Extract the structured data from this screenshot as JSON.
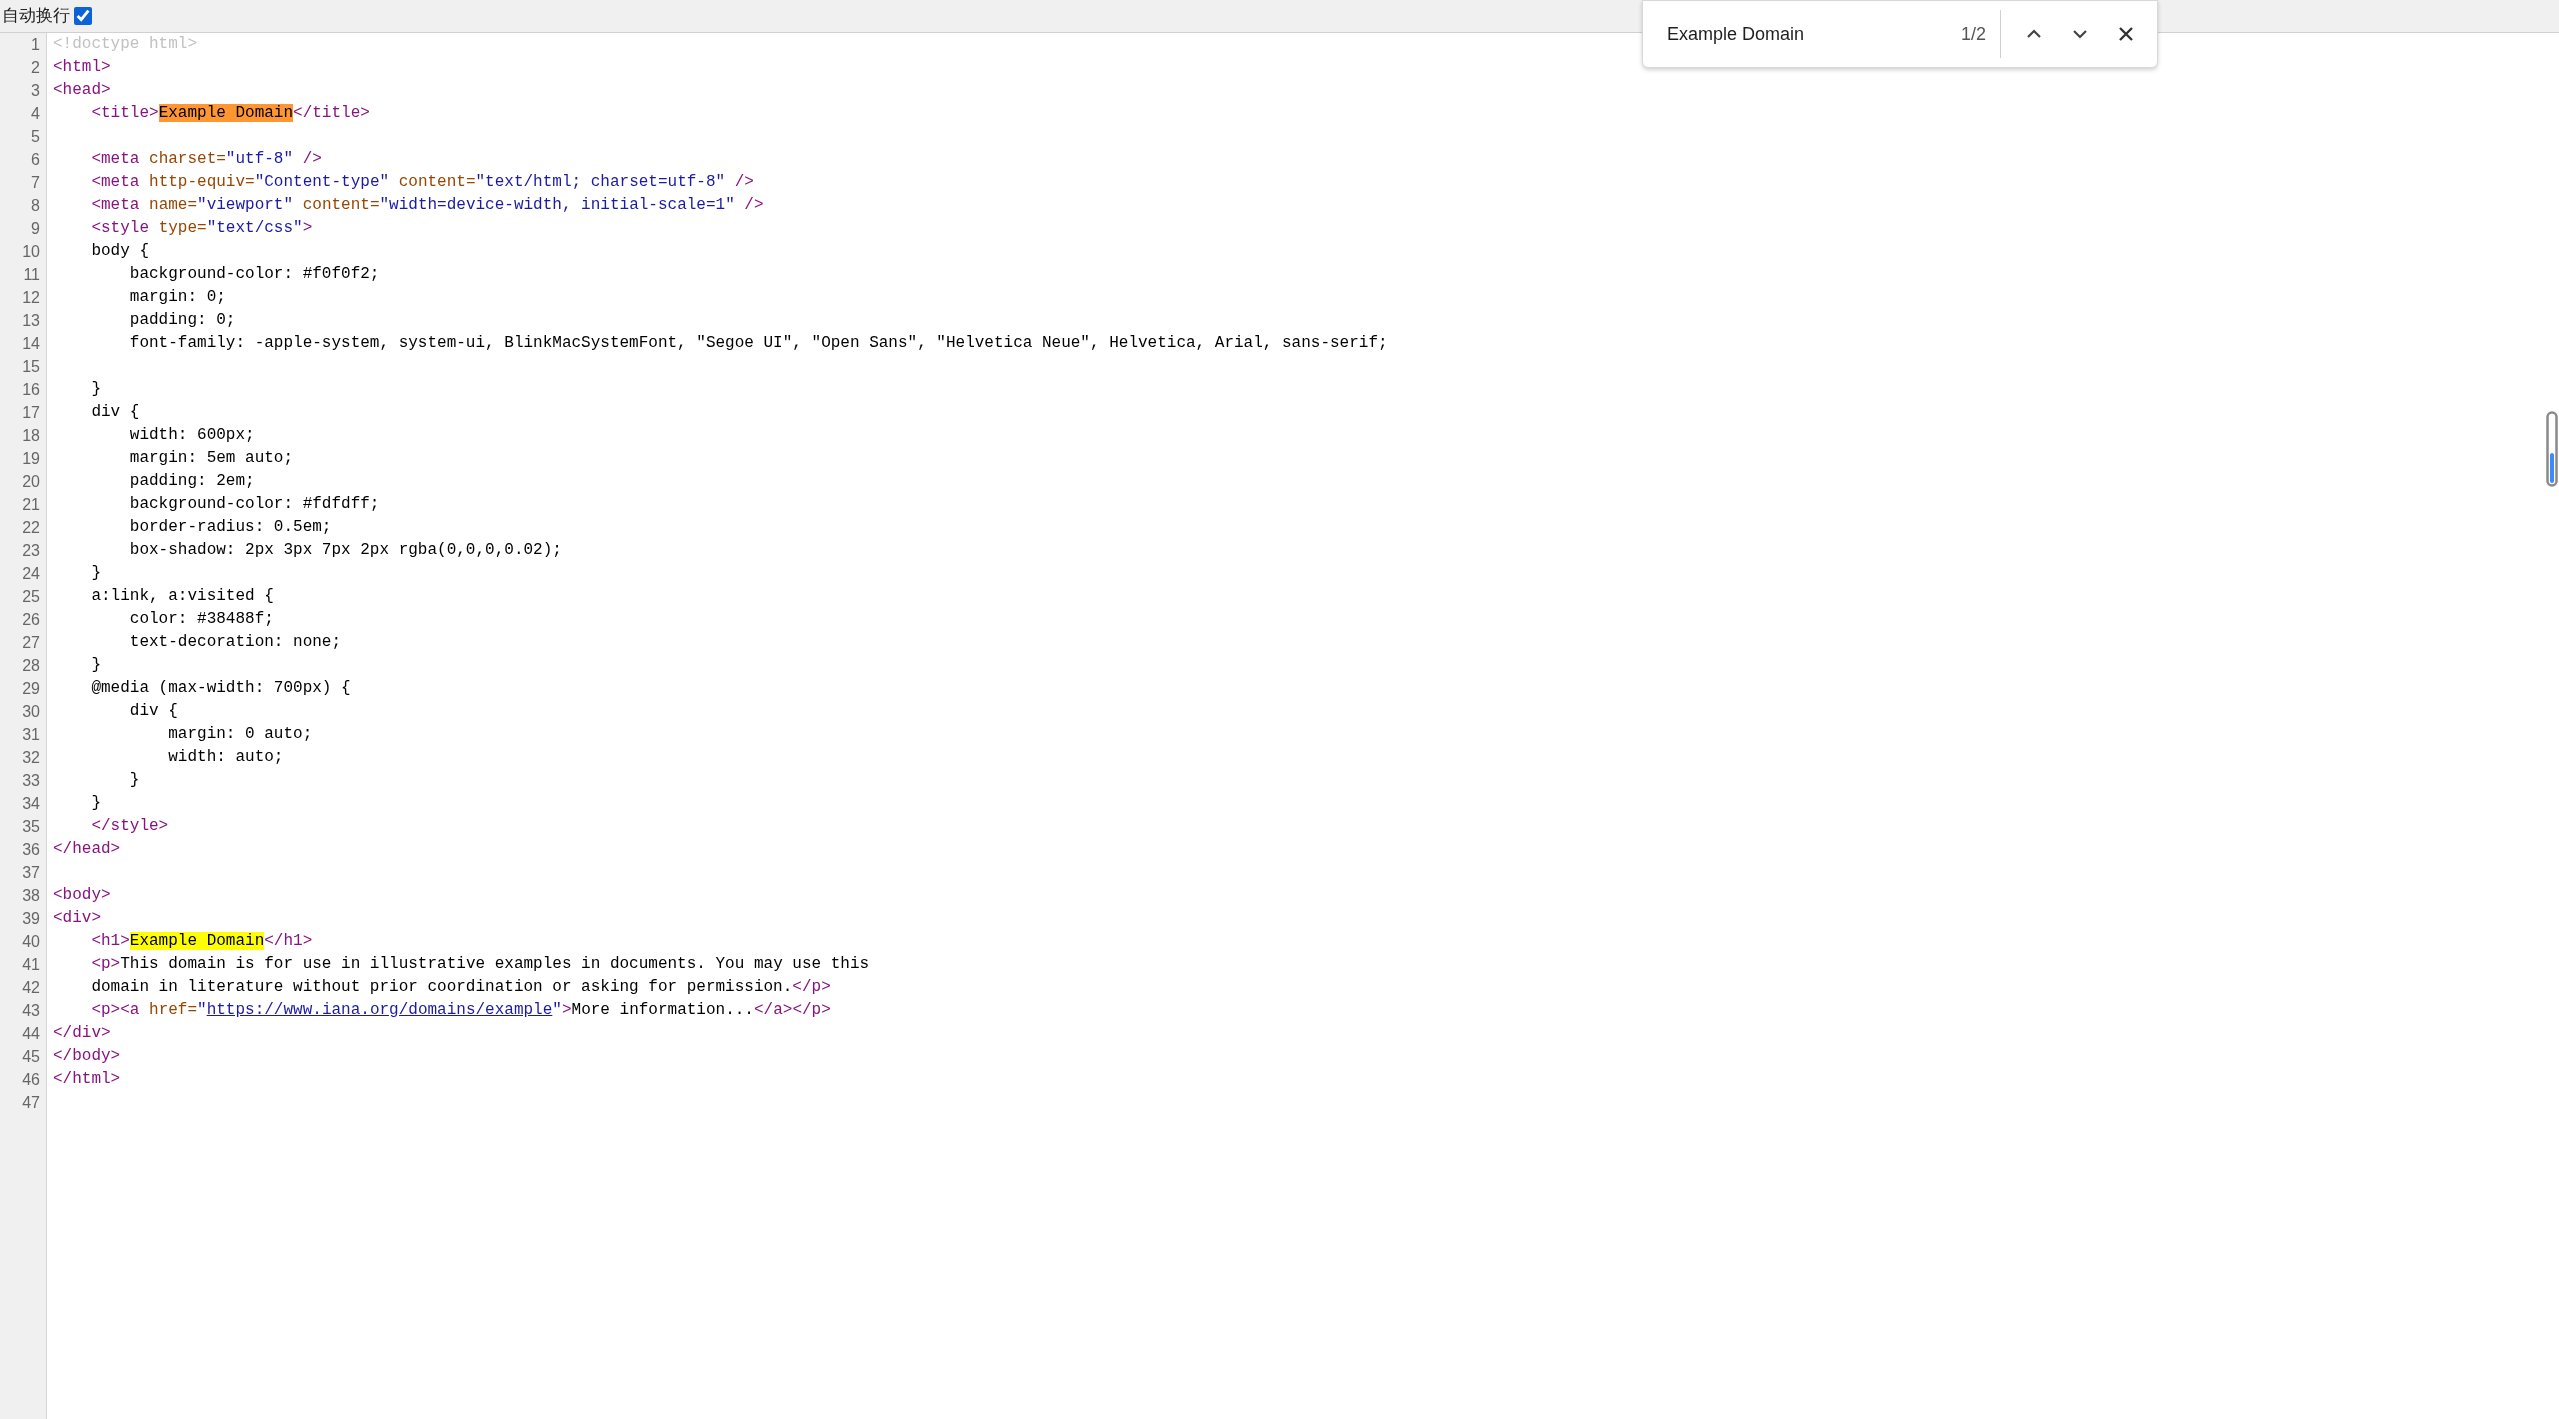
{
  "toolbar": {
    "wrap_label": "自动换行",
    "wrap_checked": true
  },
  "lines": [
    {
      "number": "1",
      "tokens": [
        {
          "kind": "doctype",
          "text": "<!doctype html>"
        }
      ]
    },
    {
      "number": "2",
      "tokens": [
        {
          "kind": "tag",
          "text": "<html>"
        }
      ]
    },
    {
      "number": "3",
      "tokens": [
        {
          "kind": "tag",
          "text": "<head>"
        }
      ]
    },
    {
      "number": "4",
      "tokens": [
        {
          "kind": "tag",
          "text": "    <title>"
        },
        {
          "kind": "match",
          "text": "Example Domain",
          "selected": true
        },
        {
          "kind": "tag",
          "text": "</title>"
        }
      ]
    },
    {
      "number": "5"
    },
    {
      "number": "6",
      "tokens": [
        {
          "kind": "tag",
          "text": "    <meta"
        },
        {
          "kind": "attr",
          "text": " charset="
        },
        {
          "kind": "value",
          "text": "\"utf-8\""
        },
        {
          "kind": "tag",
          "text": " />"
        }
      ]
    },
    {
      "number": "7",
      "tokens": [
        {
          "kind": "tag",
          "text": "    <meta"
        },
        {
          "kind": "attr",
          "text": " http-equiv="
        },
        {
          "kind": "value",
          "text": "\"Content-type\""
        },
        {
          "kind": "attr",
          "text": " content="
        },
        {
          "kind": "value",
          "text": "\"text/html; charset=utf-8\""
        },
        {
          "kind": "tag",
          "text": " />"
        }
      ]
    },
    {
      "number": "8",
      "tokens": [
        {
          "kind": "tag",
          "text": "    <meta"
        },
        {
          "kind": "attr",
          "text": " name="
        },
        {
          "kind": "value",
          "text": "\"viewport\""
        },
        {
          "kind": "attr",
          "text": " content="
        },
        {
          "kind": "value",
          "text": "\"width=device-width, initial-scale=1\""
        },
        {
          "kind": "tag",
          "text": " />"
        }
      ]
    },
    {
      "number": "9",
      "tokens": [
        {
          "kind": "tag",
          "text": "    <style"
        },
        {
          "kind": "attr",
          "text": " type="
        },
        {
          "kind": "value",
          "text": "\"text/css\""
        },
        {
          "kind": "tag",
          "text": ">"
        }
      ]
    },
    {
      "number": "10",
      "tokens": [
        {
          "kind": "text",
          "text": "    body {"
        }
      ]
    },
    {
      "number": "11",
      "tokens": [
        {
          "kind": "text",
          "text": "        background-color: #f0f0f2;"
        }
      ]
    },
    {
      "number": "12",
      "tokens": [
        {
          "kind": "text",
          "text": "        margin: 0;"
        }
      ]
    },
    {
      "number": "13",
      "tokens": [
        {
          "kind": "text",
          "text": "        padding: 0;"
        }
      ]
    },
    {
      "number": "14",
      "tokens": [
        {
          "kind": "text",
          "text": "        font-family: -apple-system, system-ui, BlinkMacSystemFont, \"Segoe UI\", \"Open Sans\", \"Helvetica Neue\", Helvetica, Arial, sans-serif;"
        }
      ]
    },
    {
      "number": "15"
    },
    {
      "number": "16",
      "tokens": [
        {
          "kind": "text",
          "text": "    }"
        }
      ]
    },
    {
      "number": "17",
      "tokens": [
        {
          "kind": "text",
          "text": "    div {"
        }
      ]
    },
    {
      "number": "18",
      "tokens": [
        {
          "kind": "text",
          "text": "        width: 600px;"
        }
      ]
    },
    {
      "number": "19",
      "tokens": [
        {
          "kind": "text",
          "text": "        margin: 5em auto;"
        }
      ]
    },
    {
      "number": "20",
      "tokens": [
        {
          "kind": "text",
          "text": "        padding: 2em;"
        }
      ]
    },
    {
      "number": "21",
      "tokens": [
        {
          "kind": "text",
          "text": "        background-color: #fdfdff;"
        }
      ]
    },
    {
      "number": "22",
      "tokens": [
        {
          "kind": "text",
          "text": "        border-radius: 0.5em;"
        }
      ]
    },
    {
      "number": "23",
      "tokens": [
        {
          "kind": "text",
          "text": "        box-shadow: 2px 3px 7px 2px rgba(0,0,0,0.02);"
        }
      ]
    },
    {
      "number": "24",
      "tokens": [
        {
          "kind": "text",
          "text": "    }"
        }
      ]
    },
    {
      "number": "25",
      "tokens": [
        {
          "kind": "text",
          "text": "    a:link, a:visited {"
        }
      ]
    },
    {
      "number": "26",
      "tokens": [
        {
          "kind": "text",
          "text": "        color: #38488f;"
        }
      ]
    },
    {
      "number": "27",
      "tokens": [
        {
          "kind": "text",
          "text": "        text-decoration: none;"
        }
      ]
    },
    {
      "number": "28",
      "tokens": [
        {
          "kind": "text",
          "text": "    }"
        }
      ]
    },
    {
      "number": "29",
      "tokens": [
        {
          "kind": "text",
          "text": "    @media (max-width: 700px) {"
        }
      ]
    },
    {
      "number": "30",
      "tokens": [
        {
          "kind": "text",
          "text": "        div {"
        }
      ]
    },
    {
      "number": "31",
      "tokens": [
        {
          "kind": "text",
          "text": "            margin: 0 auto;"
        }
      ]
    },
    {
      "number": "32",
      "tokens": [
        {
          "kind": "text",
          "text": "            width: auto;"
        }
      ]
    },
    {
      "number": "33",
      "tokens": [
        {
          "kind": "text",
          "text": "        }"
        }
      ]
    },
    {
      "number": "34",
      "tokens": [
        {
          "kind": "text",
          "text": "    }"
        }
      ]
    },
    {
      "number": "35",
      "tokens": [
        {
          "kind": "tag",
          "text": "    </style>"
        }
      ]
    },
    {
      "number": "36",
      "tokens": [
        {
          "kind": "tag",
          "text": "</head>"
        }
      ]
    },
    {
      "number": "37"
    },
    {
      "number": "38",
      "tokens": [
        {
          "kind": "tag",
          "text": "<body>"
        }
      ]
    },
    {
      "number": "39",
      "tokens": [
        {
          "kind": "tag",
          "text": "<div>"
        }
      ]
    },
    {
      "number": "40",
      "tokens": [
        {
          "kind": "tag",
          "text": "    <h1>"
        },
        {
          "kind": "match",
          "text": "Example Domain",
          "selected": false
        },
        {
          "kind": "tag",
          "text": "</h1>"
        }
      ]
    },
    {
      "number": "41",
      "tokens": [
        {
          "kind": "tag",
          "text": "    <p>"
        },
        {
          "kind": "text",
          "text": "This domain is for use in illustrative examples in documents. You may use this"
        }
      ]
    },
    {
      "number": "42",
      "tokens": [
        {
          "kind": "text",
          "text": "    domain in literature without prior coordination or asking for permission."
        },
        {
          "kind": "tag",
          "text": "</p>"
        }
      ]
    },
    {
      "number": "43",
      "tokens": [
        {
          "kind": "tag",
          "text": "    <p><a"
        },
        {
          "kind": "attr",
          "text": " href="
        },
        {
          "kind": "value",
          "text": "\""
        },
        {
          "kind": "link",
          "text": "https://www.iana.org/domains/example"
        },
        {
          "kind": "value",
          "text": "\""
        },
        {
          "kind": "tag",
          "text": ">"
        },
        {
          "kind": "text",
          "text": "More information..."
        },
        {
          "kind": "tag",
          "text": "</a></p>"
        }
      ]
    },
    {
      "number": "44",
      "tokens": [
        {
          "kind": "tag",
          "text": "</div>"
        }
      ]
    },
    {
      "number": "45",
      "tokens": [
        {
          "kind": "tag",
          "text": "</body>"
        }
      ]
    },
    {
      "number": "46",
      "tokens": [
        {
          "kind": "tag",
          "text": "</html>"
        }
      ]
    },
    {
      "number": "47"
    }
  ],
  "find_bar": {
    "query": "Example Domain",
    "count": "1/2"
  }
}
